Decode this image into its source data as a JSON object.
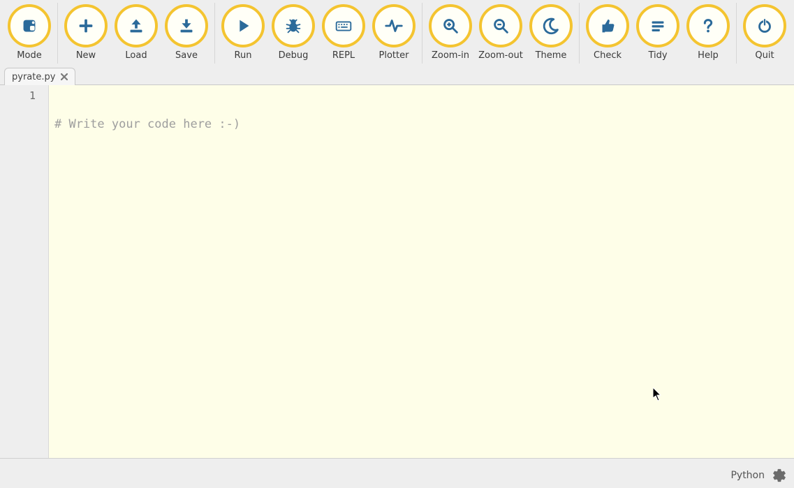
{
  "toolbar": {
    "groups": [
      {
        "items": [
          {
            "id": "mode",
            "label": "Mode",
            "icon": "mode"
          }
        ]
      },
      {
        "items": [
          {
            "id": "new",
            "label": "New",
            "icon": "plus"
          },
          {
            "id": "load",
            "label": "Load",
            "icon": "upload"
          },
          {
            "id": "save",
            "label": "Save",
            "icon": "download"
          }
        ]
      },
      {
        "items": [
          {
            "id": "run",
            "label": "Run",
            "icon": "play"
          },
          {
            "id": "debug",
            "label": "Debug",
            "icon": "bug"
          },
          {
            "id": "repl",
            "label": "REPL",
            "icon": "keyboard"
          },
          {
            "id": "plotter",
            "label": "Plotter",
            "icon": "pulse"
          }
        ]
      },
      {
        "items": [
          {
            "id": "zoom-in",
            "label": "Zoom-in",
            "icon": "zoom-in"
          },
          {
            "id": "zoom-out",
            "label": "Zoom-out",
            "icon": "zoom-out"
          },
          {
            "id": "theme",
            "label": "Theme",
            "icon": "moon"
          }
        ]
      },
      {
        "items": [
          {
            "id": "check",
            "label": "Check",
            "icon": "thumbs-up"
          },
          {
            "id": "tidy",
            "label": "Tidy",
            "icon": "lines"
          },
          {
            "id": "help",
            "label": "Help",
            "icon": "question"
          }
        ]
      },
      {
        "items": [
          {
            "id": "quit",
            "label": "Quit",
            "icon": "power"
          }
        ]
      }
    ]
  },
  "tabs": {
    "active": 0,
    "items": [
      {
        "title": "pyrate.py"
      }
    ]
  },
  "editor": {
    "lines": [
      {
        "n": "1",
        "text": "# Write your code here :-)"
      }
    ]
  },
  "statusbar": {
    "language": "Python"
  },
  "colors": {
    "icon_fill": "#2b6a9a",
    "ring": "#f4c430",
    "bg": "#eeeeee",
    "editor_bg": "#fefee8"
  }
}
